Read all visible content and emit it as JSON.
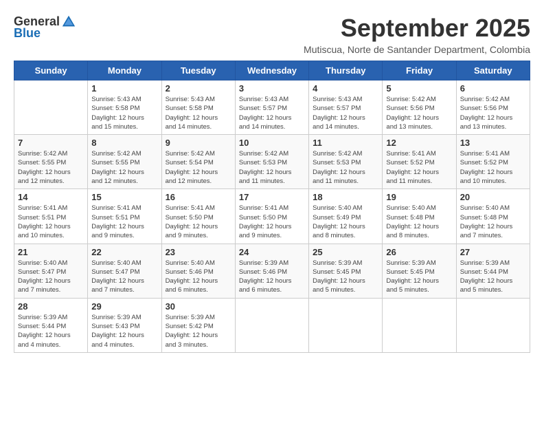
{
  "logo": {
    "general": "General",
    "blue": "Blue"
  },
  "title": "September 2025",
  "subtitle": "Mutiscua, Norte de Santander Department, Colombia",
  "days_of_week": [
    "Sunday",
    "Monday",
    "Tuesday",
    "Wednesday",
    "Thursday",
    "Friday",
    "Saturday"
  ],
  "weeks": [
    [
      {
        "day": "",
        "info": ""
      },
      {
        "day": "1",
        "info": "Sunrise: 5:43 AM\nSunset: 5:58 PM\nDaylight: 12 hours\nand 15 minutes."
      },
      {
        "day": "2",
        "info": "Sunrise: 5:43 AM\nSunset: 5:58 PM\nDaylight: 12 hours\nand 14 minutes."
      },
      {
        "day": "3",
        "info": "Sunrise: 5:43 AM\nSunset: 5:57 PM\nDaylight: 12 hours\nand 14 minutes."
      },
      {
        "day": "4",
        "info": "Sunrise: 5:43 AM\nSunset: 5:57 PM\nDaylight: 12 hours\nand 14 minutes."
      },
      {
        "day": "5",
        "info": "Sunrise: 5:42 AM\nSunset: 5:56 PM\nDaylight: 12 hours\nand 13 minutes."
      },
      {
        "day": "6",
        "info": "Sunrise: 5:42 AM\nSunset: 5:56 PM\nDaylight: 12 hours\nand 13 minutes."
      }
    ],
    [
      {
        "day": "7",
        "info": "Sunrise: 5:42 AM\nSunset: 5:55 PM\nDaylight: 12 hours\nand 12 minutes."
      },
      {
        "day": "8",
        "info": "Sunrise: 5:42 AM\nSunset: 5:55 PM\nDaylight: 12 hours\nand 12 minutes."
      },
      {
        "day": "9",
        "info": "Sunrise: 5:42 AM\nSunset: 5:54 PM\nDaylight: 12 hours\nand 12 minutes."
      },
      {
        "day": "10",
        "info": "Sunrise: 5:42 AM\nSunset: 5:53 PM\nDaylight: 12 hours\nand 11 minutes."
      },
      {
        "day": "11",
        "info": "Sunrise: 5:42 AM\nSunset: 5:53 PM\nDaylight: 12 hours\nand 11 minutes."
      },
      {
        "day": "12",
        "info": "Sunrise: 5:41 AM\nSunset: 5:52 PM\nDaylight: 12 hours\nand 11 minutes."
      },
      {
        "day": "13",
        "info": "Sunrise: 5:41 AM\nSunset: 5:52 PM\nDaylight: 12 hours\nand 10 minutes."
      }
    ],
    [
      {
        "day": "14",
        "info": "Sunrise: 5:41 AM\nSunset: 5:51 PM\nDaylight: 12 hours\nand 10 minutes."
      },
      {
        "day": "15",
        "info": "Sunrise: 5:41 AM\nSunset: 5:51 PM\nDaylight: 12 hours\nand 9 minutes."
      },
      {
        "day": "16",
        "info": "Sunrise: 5:41 AM\nSunset: 5:50 PM\nDaylight: 12 hours\nand 9 minutes."
      },
      {
        "day": "17",
        "info": "Sunrise: 5:41 AM\nSunset: 5:50 PM\nDaylight: 12 hours\nand 9 minutes."
      },
      {
        "day": "18",
        "info": "Sunrise: 5:40 AM\nSunset: 5:49 PM\nDaylight: 12 hours\nand 8 minutes."
      },
      {
        "day": "19",
        "info": "Sunrise: 5:40 AM\nSunset: 5:48 PM\nDaylight: 12 hours\nand 8 minutes."
      },
      {
        "day": "20",
        "info": "Sunrise: 5:40 AM\nSunset: 5:48 PM\nDaylight: 12 hours\nand 7 minutes."
      }
    ],
    [
      {
        "day": "21",
        "info": "Sunrise: 5:40 AM\nSunset: 5:47 PM\nDaylight: 12 hours\nand 7 minutes."
      },
      {
        "day": "22",
        "info": "Sunrise: 5:40 AM\nSunset: 5:47 PM\nDaylight: 12 hours\nand 7 minutes."
      },
      {
        "day": "23",
        "info": "Sunrise: 5:40 AM\nSunset: 5:46 PM\nDaylight: 12 hours\nand 6 minutes."
      },
      {
        "day": "24",
        "info": "Sunrise: 5:39 AM\nSunset: 5:46 PM\nDaylight: 12 hours\nand 6 minutes."
      },
      {
        "day": "25",
        "info": "Sunrise: 5:39 AM\nSunset: 5:45 PM\nDaylight: 12 hours\nand 5 minutes."
      },
      {
        "day": "26",
        "info": "Sunrise: 5:39 AM\nSunset: 5:45 PM\nDaylight: 12 hours\nand 5 minutes."
      },
      {
        "day": "27",
        "info": "Sunrise: 5:39 AM\nSunset: 5:44 PM\nDaylight: 12 hours\nand 5 minutes."
      }
    ],
    [
      {
        "day": "28",
        "info": "Sunrise: 5:39 AM\nSunset: 5:44 PM\nDaylight: 12 hours\nand 4 minutes."
      },
      {
        "day": "29",
        "info": "Sunrise: 5:39 AM\nSunset: 5:43 PM\nDaylight: 12 hours\nand 4 minutes."
      },
      {
        "day": "30",
        "info": "Sunrise: 5:39 AM\nSunset: 5:42 PM\nDaylight: 12 hours\nand 3 minutes."
      },
      {
        "day": "",
        "info": ""
      },
      {
        "day": "",
        "info": ""
      },
      {
        "day": "",
        "info": ""
      },
      {
        "day": "",
        "info": ""
      }
    ]
  ]
}
